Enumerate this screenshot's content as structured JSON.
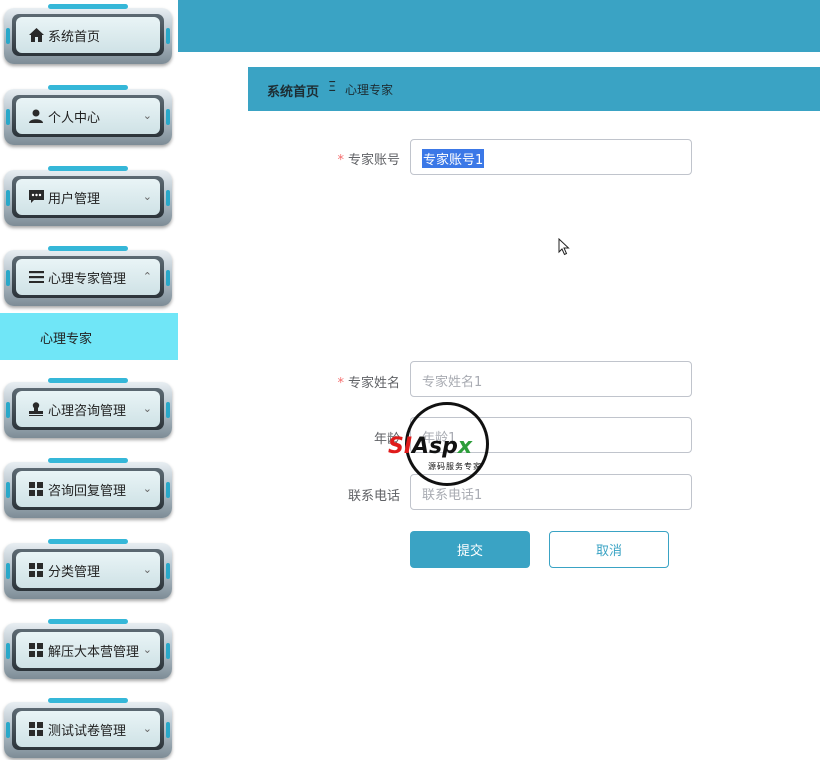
{
  "sidebar": {
    "items": [
      {
        "label": "系统首页",
        "icon": "home-icon",
        "chevron": ""
      },
      {
        "label": "个人中心",
        "icon": "user-icon",
        "chevron": "⌄"
      },
      {
        "label": "用户管理",
        "icon": "chat-icon",
        "chevron": "⌄"
      },
      {
        "label": "心理专家管理",
        "icon": "list-icon",
        "chevron": "⌃"
      },
      {
        "label": "心理咨询管理",
        "icon": "stamp-icon",
        "chevron": "⌄"
      },
      {
        "label": "咨询回复管理",
        "icon": "grid-icon",
        "chevron": "⌄"
      },
      {
        "label": "分类管理",
        "icon": "grid-icon",
        "chevron": "⌄"
      },
      {
        "label": "解压大本营管理",
        "icon": "grid-icon",
        "chevron": "⌄"
      },
      {
        "label": "测试试卷管理",
        "icon": "grid-icon",
        "chevron": "⌄"
      }
    ],
    "submenu_active": "心理专家"
  },
  "breadcrumb": {
    "home": "系统首页",
    "separator": "Ξ",
    "current": "心理专家"
  },
  "form": {
    "account_label": "专家账号",
    "account_value": "专家账号1",
    "name_label": "专家姓名",
    "name_placeholder": "专家姓名1",
    "age_label": "年龄",
    "age_placeholder": "年龄1",
    "phone_label": "联系电话",
    "phone_placeholder": "联系电话1",
    "required_mark": "*"
  },
  "buttons": {
    "submit": "提交",
    "cancel": "取消"
  },
  "watermark": {
    "text": "SIAspx",
    "subtitle": "源码服务专家"
  },
  "colors": {
    "accent": "#3aa3c4",
    "submenu_bg": "#70e6f7",
    "required": "#f56c6c"
  }
}
